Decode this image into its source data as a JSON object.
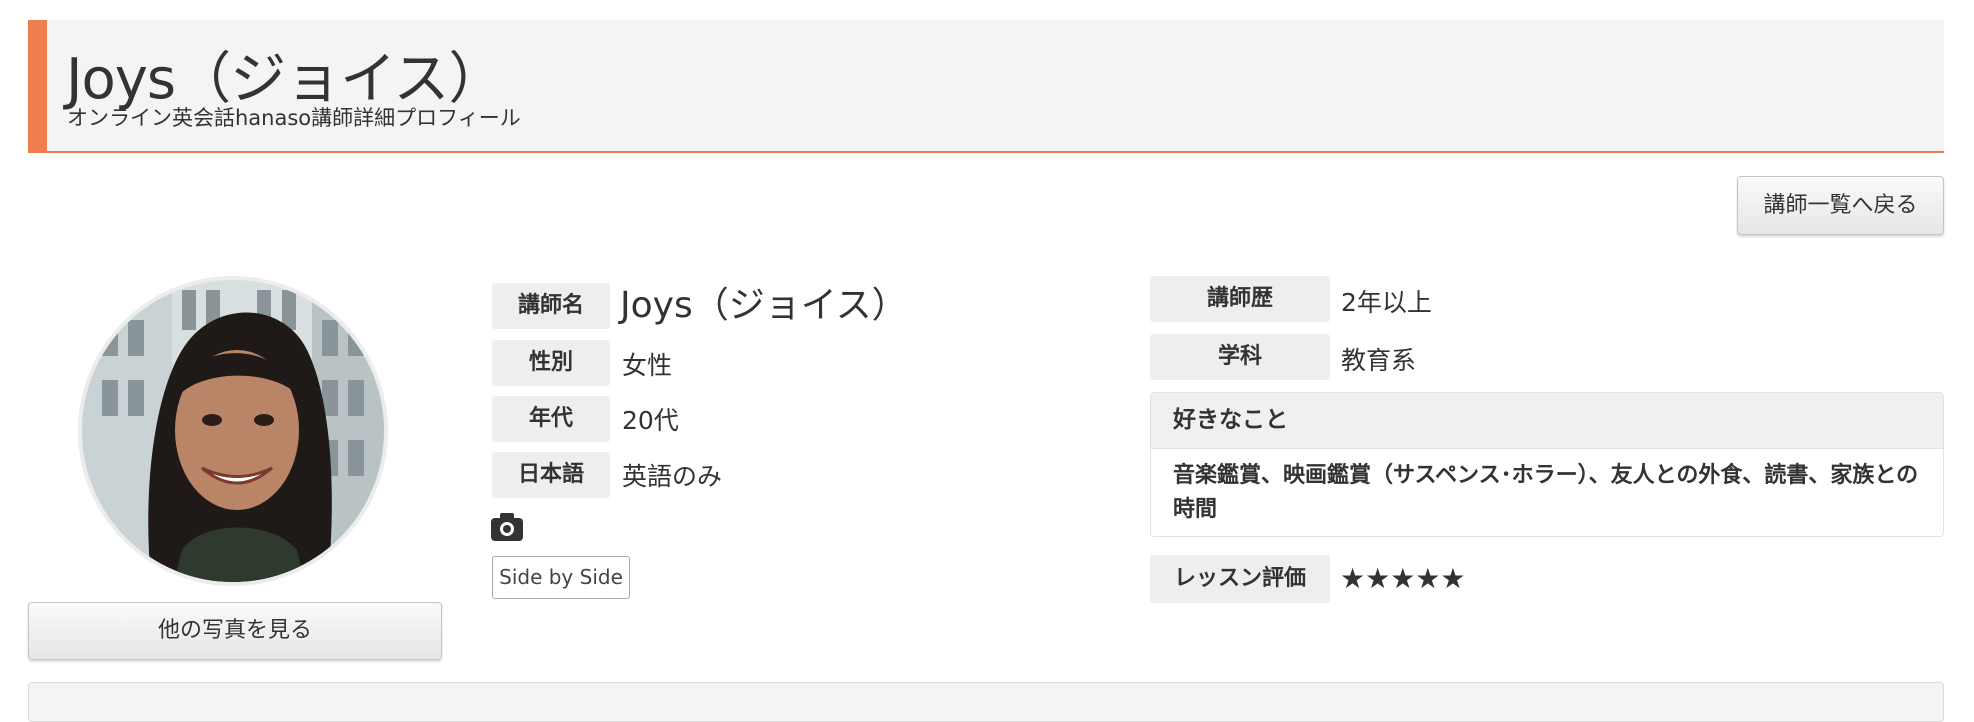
{
  "header": {
    "title": "Joys（ジョイス）",
    "subtitle": "オンライン英会話hanaso講師詳細プロフィール",
    "accent_color": "#ee7e4f"
  },
  "actions": {
    "back_label": "講師一覧へ戻る",
    "photos_label": "他の写真を見る"
  },
  "profile_left": {
    "name_label": "講師名",
    "name_value": "Joys（ジョイス）",
    "gender_label": "性別",
    "gender_value": "女性",
    "age_label": "年代",
    "age_value": "20代",
    "japanese_label": "日本語",
    "japanese_value": "英語のみ",
    "camera_icon": "camera-icon",
    "sbs_label": "Side by Side"
  },
  "profile_right": {
    "career_label": "講師歴",
    "career_value": "2年以上",
    "major_label": "学科",
    "major_value": "教育系",
    "likes_label": "好きなこと",
    "likes_value": "音楽鑑賞、映画鑑賞（サスペンス･ホラー）、友人との外食、読書、家族との時間",
    "rating_label": "レッスン評価",
    "rating_stars": "★★★★★",
    "rating_value": 5
  }
}
